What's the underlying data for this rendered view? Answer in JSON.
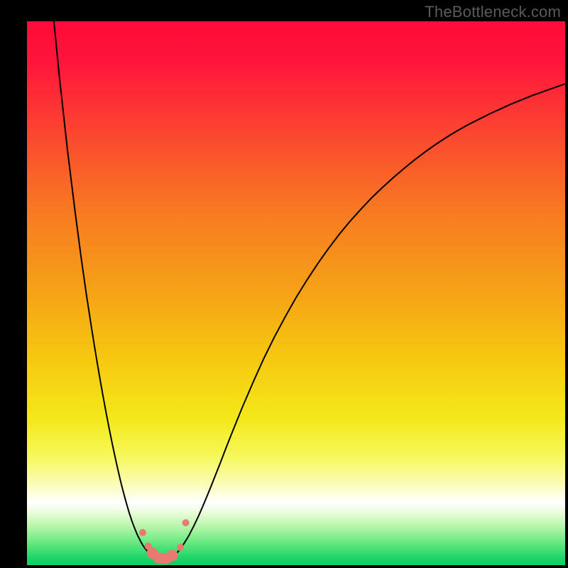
{
  "watermark": "TheBottleneck.com",
  "chart_data": {
    "type": "line",
    "title": "",
    "xlabel": "",
    "ylabel": "",
    "xlim": [
      0,
      100
    ],
    "ylim": [
      0,
      100
    ],
    "grid": false,
    "legend": false,
    "background": {
      "type": "vertical-gradient",
      "stops": [
        {
          "offset": 0.0,
          "color": "#ff0a3a"
        },
        {
          "offset": 0.08,
          "color": "#ff173b"
        },
        {
          "offset": 0.2,
          "color": "#fb4430"
        },
        {
          "offset": 0.35,
          "color": "#f77a22"
        },
        {
          "offset": 0.5,
          "color": "#f6a316"
        },
        {
          "offset": 0.62,
          "color": "#f6c810"
        },
        {
          "offset": 0.73,
          "color": "#f4e81a"
        },
        {
          "offset": 0.8,
          "color": "#f6f85b"
        },
        {
          "offset": 0.85,
          "color": "#fbfcb6"
        },
        {
          "offset": 0.885,
          "color": "#ffffff"
        },
        {
          "offset": 0.905,
          "color": "#e8fcd8"
        },
        {
          "offset": 0.93,
          "color": "#b4f6a8"
        },
        {
          "offset": 0.96,
          "color": "#63e77f"
        },
        {
          "offset": 0.985,
          "color": "#1fd66a"
        },
        {
          "offset": 1.0,
          "color": "#0ccf63"
        }
      ]
    },
    "series": [
      {
        "name": "bottleneck-curve",
        "color": "#000000",
        "width": 2,
        "x": [
          5.0,
          5.5,
          6.0,
          6.5,
          7.0,
          7.5,
          8.0,
          8.5,
          9.0,
          9.5,
          10.0,
          10.5,
          11.0,
          11.5,
          12.0,
          12.5,
          13.0,
          13.5,
          14.0,
          14.5,
          15.0,
          15.5,
          16.0,
          16.5,
          17.0,
          17.5,
          18.0,
          18.5,
          19.0,
          19.5,
          20.0,
          20.5,
          21.0,
          21.5,
          22.0,
          22.5,
          23.0,
          23.5,
          24.0,
          24.5,
          25.0,
          25.5,
          26.0,
          26.5,
          27.0,
          27.5,
          28.0,
          28.5,
          29.0,
          30.0,
          31.0,
          32.0,
          33.0,
          34.0,
          35.0,
          36.0,
          37.0,
          38.0,
          40.0,
          42.0,
          44.0,
          46.0,
          48.0,
          50.0,
          52.0,
          54.0,
          56.0,
          58.0,
          60.0,
          62.0,
          64.0,
          66.0,
          68.0,
          70.0,
          72.0,
          74.0,
          76.0,
          78.0,
          80.0,
          82.0,
          84.0,
          86.0,
          88.0,
          90.0,
          92.0,
          94.0,
          96.0,
          98.0,
          100.0
        ],
        "y": [
          100.0,
          95.0,
          90.0,
          85.5,
          81.0,
          76.5,
          72.5,
          68.5,
          64.5,
          60.8,
          57.0,
          53.5,
          50.0,
          46.8,
          43.6,
          40.5,
          37.5,
          34.6,
          31.8,
          29.1,
          26.5,
          24.0,
          21.6,
          19.3,
          17.1,
          15.0,
          13.1,
          11.3,
          9.6,
          8.1,
          6.8,
          5.6,
          4.6,
          3.7,
          3.0,
          2.4,
          1.9,
          1.5,
          1.2,
          1.0,
          0.9,
          0.9,
          1.0,
          1.2,
          1.5,
          1.9,
          2.4,
          3.0,
          3.7,
          5.3,
          7.2,
          9.3,
          11.6,
          14.0,
          16.5,
          19.0,
          21.6,
          24.1,
          29.0,
          33.6,
          38.0,
          42.0,
          45.7,
          49.2,
          52.4,
          55.4,
          58.2,
          60.8,
          63.2,
          65.4,
          67.5,
          69.4,
          71.2,
          72.9,
          74.5,
          76.0,
          77.4,
          78.7,
          79.9,
          81.0,
          82.0,
          83.0,
          83.9,
          84.8,
          85.6,
          86.4,
          87.1,
          87.8,
          88.5
        ]
      }
    ],
    "markers": {
      "name": "valley-markers",
      "color": "#e97a72",
      "radius_small": 5,
      "radius_large": 8,
      "points": [
        {
          "x": 21.5,
          "y": 6.0,
          "r": "small"
        },
        {
          "x": 22.5,
          "y": 3.5,
          "r": "small"
        },
        {
          "x": 23.3,
          "y": 2.2,
          "r": "large"
        },
        {
          "x": 24.5,
          "y": 1.3,
          "r": "large"
        },
        {
          "x": 25.8,
          "y": 1.2,
          "r": "large"
        },
        {
          "x": 27.0,
          "y": 1.8,
          "r": "large"
        },
        {
          "x": 28.5,
          "y": 3.3,
          "r": "small"
        },
        {
          "x": 29.5,
          "y": 7.8,
          "r": "small"
        }
      ]
    }
  }
}
